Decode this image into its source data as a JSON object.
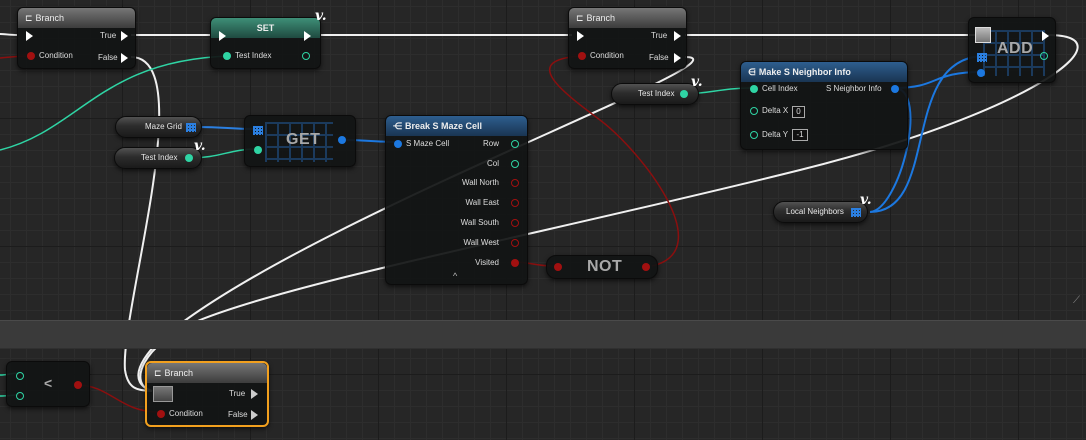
{
  "nodes": {
    "branch_top_left": {
      "title": "Branch",
      "condition": "Condition",
      "true_label": "True",
      "false_label": "False"
    },
    "set_node": {
      "title": "SET",
      "pin": "Test Index"
    },
    "branch_top_mid": {
      "title": "Branch",
      "condition": "Condition",
      "true_label": "True",
      "false_label": "False"
    },
    "add_node": {
      "title": "ADD"
    },
    "maze_grid": {
      "label": "Maze Grid"
    },
    "test_index_a": {
      "label": "Test Index"
    },
    "test_index_b": {
      "label": "Test Index"
    },
    "get_node": {
      "title": "GET"
    },
    "break_node": {
      "title": "Break S Maze Cell",
      "input": "S Maze Cell",
      "outputs": [
        "Row",
        "Col",
        "Wall North",
        "Wall East",
        "Wall South",
        "Wall West",
        "Visited"
      ],
      "expand": "^"
    },
    "make_node": {
      "title": "Make S Neighbor Info",
      "inputs": [
        "Cell Index",
        "Delta X",
        "Delta Y"
      ],
      "output": "S Neighbor Info",
      "delta_x": "0",
      "delta_y": "-1"
    },
    "not_node": {
      "title": "NOT"
    },
    "local_neighbors": {
      "label": "Local Neighbors"
    },
    "less_node": {
      "title": "<"
    },
    "branch_bottom": {
      "title": "Branch",
      "condition": "Condition",
      "true_label": "True",
      "false_label": "False"
    }
  },
  "variable_marker": "v.",
  "colors": {
    "exec": "#ffffff",
    "int": "#2fd4a4",
    "bool": "#a11010",
    "struct": "#1c78e0",
    "selection": "#f2a01e"
  }
}
